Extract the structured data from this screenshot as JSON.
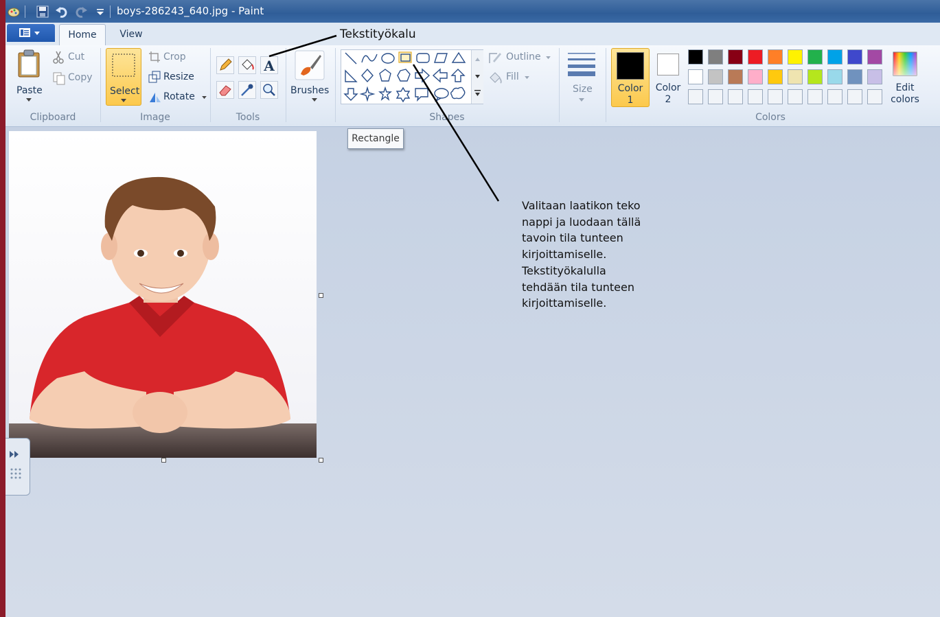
{
  "window": {
    "title": "boys-286243_640.jpg - Paint"
  },
  "tabs": [
    {
      "label": "Home",
      "active": true
    },
    {
      "label": "View",
      "active": false
    }
  ],
  "ribbon": {
    "clipboard": {
      "group_label": "Clipboard",
      "paste_label": "Paste",
      "cut_label": "Cut",
      "copy_label": "Copy"
    },
    "image": {
      "group_label": "Image",
      "select_label": "Select",
      "crop_label": "Crop",
      "resize_label": "Resize",
      "rotate_label": "Rotate"
    },
    "tools": {
      "group_label": "Tools",
      "items": [
        "pencil-icon",
        "fill-bucket-icon",
        "text-tool-icon",
        "eraser-icon",
        "color-picker-icon",
        "magnifier-icon"
      ]
    },
    "brushes": {
      "label": "Brushes"
    },
    "shapes": {
      "group_label": "Shapes",
      "outline_label": "Outline",
      "fill_label": "Fill",
      "selected_shape": "Rectangle"
    },
    "size": {
      "label": "Size"
    },
    "colors": {
      "group_label": "Colors",
      "color1_label": "Color\n1",
      "color2_label": "Color\n2",
      "color1_value": "#000000",
      "color2_value": "#ffffff",
      "edit_colors_label": "Edit\ncolors",
      "palette_row1": [
        "#000000",
        "#7f7f7f",
        "#880015",
        "#ed1c24",
        "#ff7f27",
        "#fff200",
        "#22b14c",
        "#00a2e8",
        "#3f48cc",
        "#a349a4"
      ],
      "palette_row2": [
        "#ffffff",
        "#c3c3c3",
        "#b97a57",
        "#ffaec9",
        "#ffc90e",
        "#efe4b0",
        "#b5e61d",
        "#99d9ea",
        "#7092be",
        "#c8bfe7"
      ]
    }
  },
  "tooltip": {
    "text": "Rectangle"
  },
  "annotations": {
    "label": "Tekstityökalu",
    "text": "Valitaan laatikon teko\nnappi ja luodaan tällä\ntavoin tila tunteen\nkirjoittamiselle.\nTekstityökalulla\ntehdään tila tunteen\nkirjoittamiselle."
  },
  "colors": {
    "titlebar": "#2f5d98",
    "ribbon_bg": "#e6edf7",
    "canvas_bg": "#c9d5e6",
    "selected_highlight": "#fcd56b",
    "frame": "#8c1b2a"
  }
}
